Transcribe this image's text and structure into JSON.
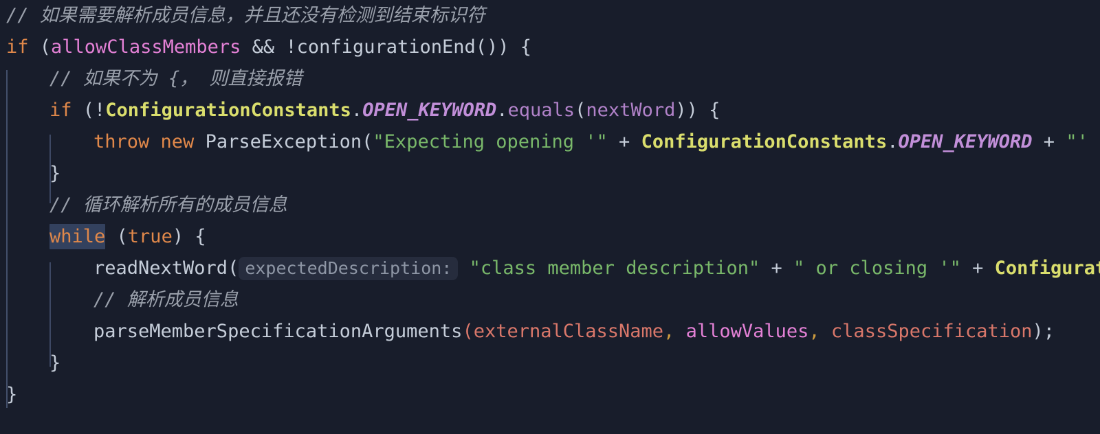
{
  "editor": {
    "background_color": "#181d2b",
    "language": "Java",
    "theme": "dark",
    "colors": {
      "keyword": "#e0884a",
      "comment": "#9aa0ab",
      "class_name": "#dade6d",
      "static_constant": "#c28fd9",
      "string": "#79b86a",
      "default_text": "#c5cdd9",
      "field": "#e481d6",
      "parameter": "#d9776a",
      "method": "#b182c9",
      "comma": "#cc9b3f",
      "inlay_hint_text": "#8e96a5",
      "inlay_hint_background": "#262c3d",
      "selection_highlight": "#33415e",
      "indent_guide": "#434f6b"
    }
  },
  "code": {
    "line1": {
      "comment": "// 如果需要解析成员信息，并且还没有检测到结束标识符"
    },
    "line2": {
      "kw_if": "if",
      "paren_open": " (",
      "field": "allowClassMembers",
      "op_and": " && ",
      "not_call": "!configurationEnd()) {"
    },
    "line3": {
      "comment": "// 如果不为 {， 则直接报错"
    },
    "line4": {
      "kw_if": "if",
      "paren_not": " (!",
      "class_name": "ConfigurationConstants",
      "dot": ".",
      "constant": "OPEN_KEYWORD",
      "dot2": ".",
      "method": "equals",
      "paren_open": "(",
      "arg": "nextWord",
      "tail": ")) {"
    },
    "line5": {
      "kw_throw": "throw",
      "space1": " ",
      "kw_new": "new",
      "exception": " ParseException(",
      "string1": "\"Expecting opening '\"",
      "plus1": " + ",
      "class_name": "ConfigurationConstants",
      "dot": ".",
      "constant": "OPEN_KEYWORD",
      "plus2": " + ",
      "string2": "\"' at "
    },
    "line6": {
      "brace": "}"
    },
    "line7": {
      "comment": "// 循环解析所有的成员信息"
    },
    "line8": {
      "kw_while": "while",
      "cond": " (",
      "kw_true": "true",
      "tail": ") {"
    },
    "line9": {
      "method": "readNextWord(",
      "hint": "expectedDescription:",
      "string1": "\"class member description\"",
      "plus1": " + ",
      "string2": "\" or closing '\"",
      "plus2": " + ",
      "class_name": "Configurat"
    },
    "line10": {
      "comment": "// 解析成员信息"
    },
    "line11": {
      "method": "parseMemberSpecificationArguments",
      "paren_open": "(",
      "param1": "externalClassName",
      "comma1": ",",
      "param2": "allowValues",
      "comma2": ",",
      "param3": "classSpecification",
      "tail": ");"
    },
    "line12": {
      "brace": "}"
    },
    "line13": {
      "brace": "}"
    }
  }
}
